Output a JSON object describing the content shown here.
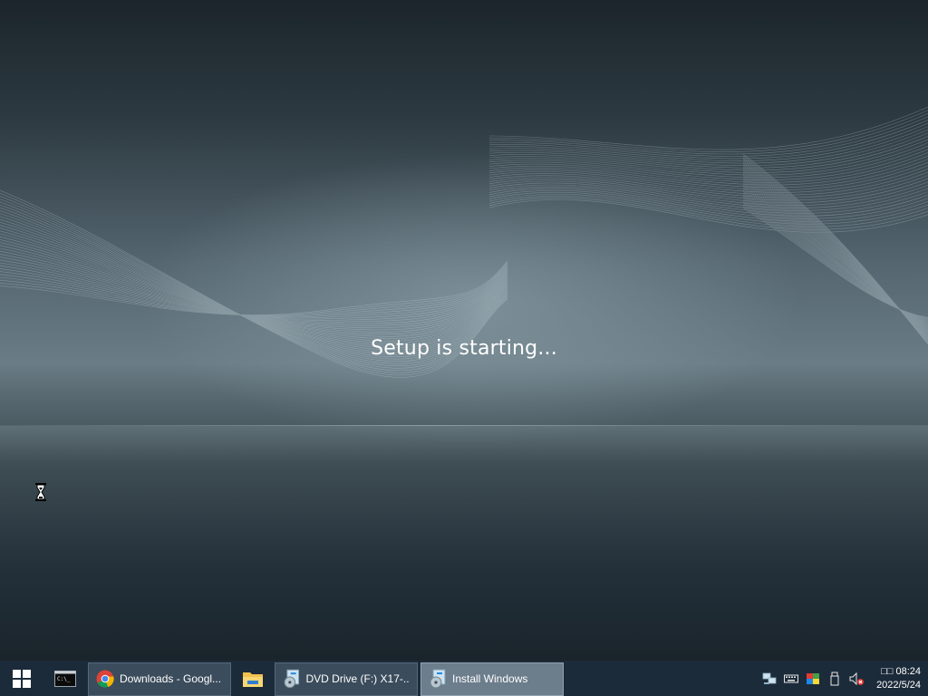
{
  "window": {
    "status_text": "Setup is starting..."
  },
  "taskbar": {
    "pinned": [
      {
        "name": "start",
        "icon": "windows-logo-icon"
      },
      {
        "name": "command-prompt",
        "icon": "terminal-icon"
      },
      {
        "name": "file-explorer",
        "icon": "folder-icon"
      }
    ],
    "tasks": [
      {
        "label": "Downloads - Googl...",
        "icon": "chrome-icon",
        "active": false
      },
      {
        "label": "DVD Drive (F:) X17-...",
        "icon": "setup-disc-icon",
        "active": false
      },
      {
        "label": "Install Windows",
        "icon": "setup-disc-icon",
        "active": true
      }
    ],
    "tray": {
      "icons": [
        "network-icon",
        "keyboard-icon",
        "display-color-icon",
        "usb-drive-icon",
        "volume-muted-icon"
      ],
      "clock_time": "□□ 08:24",
      "clock_date": "2022/5/24"
    }
  },
  "colors": {
    "taskbar_bg": "#1c2b3a",
    "active_task_bg": "#6c7d8c",
    "task_bg": "#3b4c5c"
  }
}
